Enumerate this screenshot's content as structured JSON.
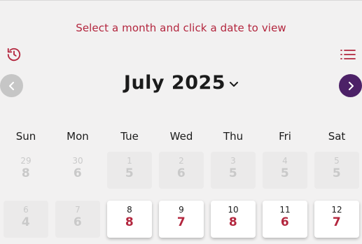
{
  "header": {
    "instruction": "Select a month and click a date to view",
    "history_icon": "history-icon",
    "list_icon": "list-icon"
  },
  "nav": {
    "month_year": "July 2025",
    "prev_icon": "chevron-left-icon",
    "next_icon": "chevron-right-icon",
    "caret_icon": "chevron-down-icon"
  },
  "weekdays": [
    "Sun",
    "Mon",
    "Tue",
    "Wed",
    "Thu",
    "Fri",
    "Sat"
  ],
  "weeks": [
    [
      {
        "day": "29",
        "value": "8",
        "state": "out"
      },
      {
        "day": "30",
        "value": "6",
        "state": "out"
      },
      {
        "day": "1",
        "value": "5",
        "state": "past"
      },
      {
        "day": "2",
        "value": "6",
        "state": "past"
      },
      {
        "day": "3",
        "value": "5",
        "state": "past"
      },
      {
        "day": "4",
        "value": "5",
        "state": "past"
      },
      {
        "day": "5",
        "value": "5",
        "state": "past"
      }
    ],
    [
      {
        "day": "6",
        "value": "4",
        "state": "past"
      },
      {
        "day": "7",
        "value": "6",
        "state": "past"
      },
      {
        "day": "8",
        "value": "8",
        "state": "active"
      },
      {
        "day": "9",
        "value": "7",
        "state": "active"
      },
      {
        "day": "10",
        "value": "8",
        "state": "active"
      },
      {
        "day": "11",
        "value": "6",
        "state": "active"
      },
      {
        "day": "12",
        "value": "7",
        "state": "active"
      }
    ]
  ],
  "colors": {
    "accent": "#b3263e",
    "next_button": "#4c2167",
    "prev_button": "#c6c6c6",
    "background": "#f2f1f1"
  }
}
